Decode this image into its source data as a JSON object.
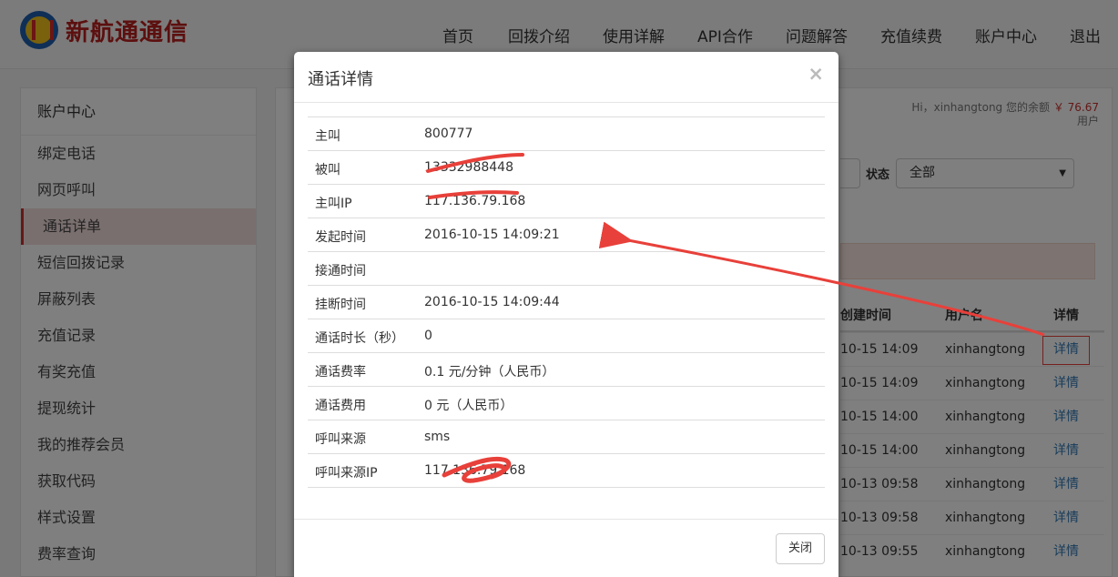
{
  "brand": {
    "name": "新航通通信"
  },
  "nav": [
    {
      "label": "首页"
    },
    {
      "label": "回拨介绍"
    },
    {
      "label": "使用详解"
    },
    {
      "label": "API合作"
    },
    {
      "label": "问题解答"
    },
    {
      "label": "充值续费"
    },
    {
      "label": "账户中心"
    },
    {
      "label": "退出"
    }
  ],
  "sidebar": {
    "title": "账户中心",
    "items": [
      {
        "label": "绑定电话"
      },
      {
        "label": "网页呼叫"
      },
      {
        "label": "通话详单"
      },
      {
        "label": "短信回拨记录"
      },
      {
        "label": "屏蔽列表"
      },
      {
        "label": "充值记录"
      },
      {
        "label": "有奖充值"
      },
      {
        "label": "提现统计"
      },
      {
        "label": "我的推荐会员"
      },
      {
        "label": "获取代码"
      },
      {
        "label": "样式设置"
      },
      {
        "label": "费率查询"
      }
    ]
  },
  "account": {
    "greeting": "Hi，xinhangtong 您的余额",
    "balance": "￥ 76.67",
    "suffix": "用户"
  },
  "filter": {
    "status_label": "状态",
    "status_value": "全部"
  },
  "table": {
    "headers": {
      "created": "创建时间",
      "user": "用户名",
      "detail": "详情"
    },
    "rows": [
      {
        "created": "10-15 14:09",
        "user": "xinhangtong",
        "detail": "详情"
      },
      {
        "created": "10-15 14:09",
        "user": "xinhangtong",
        "detail": "详情"
      },
      {
        "created": "10-15 14:00",
        "user": "xinhangtong",
        "detail": "详情"
      },
      {
        "created": "10-15 14:00",
        "user": "xinhangtong",
        "detail": "详情"
      },
      {
        "created": "10-13 09:58",
        "user": "xinhangtong",
        "detail": "详情"
      },
      {
        "created": "10-13 09:58",
        "user": "xinhangtong",
        "detail": "详情"
      },
      {
        "created": "10-13 09:55",
        "user": "xinhangtong",
        "detail": "详情"
      }
    ]
  },
  "modal": {
    "title": "通话详情",
    "close_symbol": "×",
    "rows": [
      {
        "label": "主叫",
        "value": "800777"
      },
      {
        "label": "被叫",
        "value": "13332988448"
      },
      {
        "label": "主叫IP",
        "value": "117.136.79.168"
      },
      {
        "label": "发起时间",
        "value": "2016-10-15 14:09:21"
      },
      {
        "label": "接通时间",
        "value": ""
      },
      {
        "label": "挂断时间",
        "value": "2016-10-15 14:09:44"
      },
      {
        "label": "通话时长（秒）",
        "value": "0"
      },
      {
        "label": "通话费率",
        "value": "0.1 元/分钟（人民币）"
      },
      {
        "label": "通话费用",
        "value": "0 元（人民币）"
      },
      {
        "label": "呼叫来源",
        "value": "sms"
      },
      {
        "label": "呼叫来源IP",
        "value": "117.136.79.168"
      }
    ],
    "close_button": "关闭"
  },
  "colors": {
    "accent_red": "#c9302c",
    "link_blue": "#337ab7",
    "annotation_red": "#e8403a"
  }
}
